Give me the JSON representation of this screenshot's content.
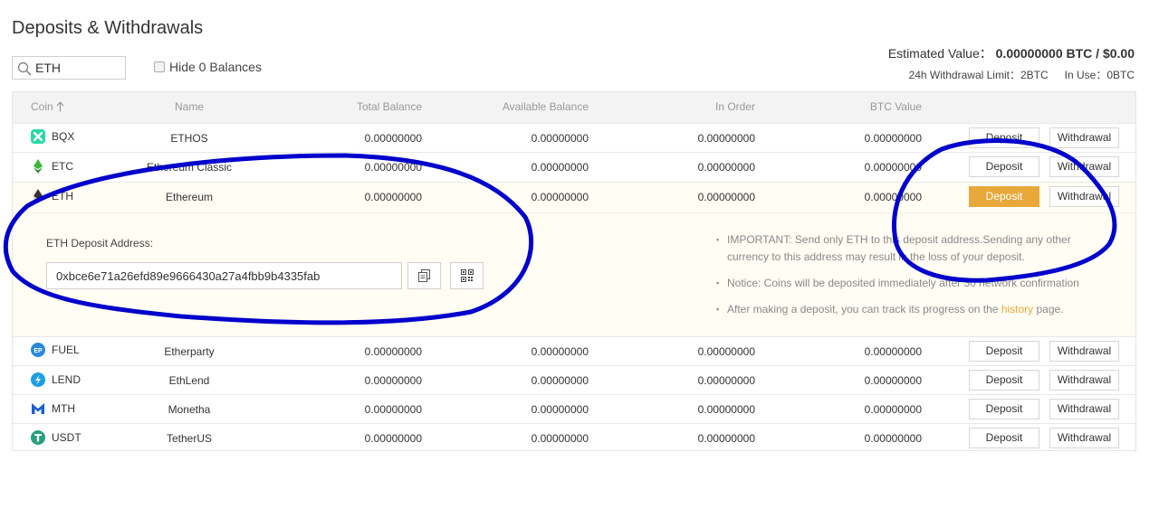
{
  "page": {
    "title": "Deposits & Withdrawals"
  },
  "search": {
    "value": "ETH"
  },
  "filter": {
    "hide_zero_label": "Hide 0 Balances"
  },
  "summary": {
    "estimated_label": "Estimated Value：",
    "estimated_btc": "0.00000000 BTC",
    "separator": " / ",
    "estimated_usd": "$0.00",
    "limit_text": "24h Withdrawal Limit：2BTC",
    "in_use_text": "In Use：0BTC"
  },
  "table": {
    "headers": {
      "coin": "Coin",
      "name": "Name",
      "total": "Total Balance",
      "available": "Available Balance",
      "in_order": "In Order",
      "btc_value": "BTC Value"
    },
    "deposit_label": "Deposit",
    "withdraw_label": "Withdrawal",
    "rows": [
      {
        "symbol": "BQX",
        "name": "ETHOS",
        "total": "0.00000000",
        "available": "0.00000000",
        "in_order": "0.00000000",
        "btc_value": "0.00000000",
        "icon": "bqx-icon",
        "color": "#2bd9a5"
      },
      {
        "symbol": "ETC",
        "name": "Ethereum Classic",
        "total": "0.00000000",
        "available": "0.00000000",
        "in_order": "0.00000000",
        "btc_value": "0.00000000",
        "icon": "etc-icon",
        "color": "#3ab83a"
      },
      {
        "symbol": "ETH",
        "name": "Ethereum",
        "total": "0.00000000",
        "available": "0.00000000",
        "in_order": "0.00000000",
        "btc_value": "0.00000000",
        "icon": "eth-icon",
        "color": "#343434"
      },
      {
        "symbol": "FUEL",
        "name": "Etherparty",
        "total": "0.00000000",
        "available": "0.00000000",
        "in_order": "0.00000000",
        "btc_value": "0.00000000",
        "icon": "fuel-icon",
        "color": "#2a8ad8"
      },
      {
        "symbol": "LEND",
        "name": "EthLend",
        "total": "0.00000000",
        "available": "0.00000000",
        "in_order": "0.00000000",
        "btc_value": "0.00000000",
        "icon": "lend-icon",
        "color": "#1ba0e5"
      },
      {
        "symbol": "MTH",
        "name": "Monetha",
        "total": "0.00000000",
        "available": "0.00000000",
        "in_order": "0.00000000",
        "btc_value": "0.00000000",
        "icon": "mth-icon",
        "color": "#1d5fd1"
      },
      {
        "symbol": "USDT",
        "name": "TetherUS",
        "total": "0.00000000",
        "available": "0.00000000",
        "in_order": "0.00000000",
        "btc_value": "0.00000000",
        "icon": "usdt-icon",
        "color": "#26a17b"
      }
    ]
  },
  "deposit_panel": {
    "address_label": "ETH Deposit Address:",
    "address": "0xbce6e71a26efd89e9666430a27a4fbb9b4335fab",
    "notes": {
      "important": "IMPORTANT: Send only ETH to this deposit address.Sending any other currency to this address may result in the loss of your deposit.",
      "notice": "Notice: Coins will be deposited immediately after 30 network confirmation",
      "tracking_prefix": "After making a deposit, you can track its progress on the ",
      "history_link": "history",
      "tracking_suffix": " page."
    }
  },
  "colors": {
    "accent": "#e8a93a",
    "annotation": "#0000cc"
  }
}
